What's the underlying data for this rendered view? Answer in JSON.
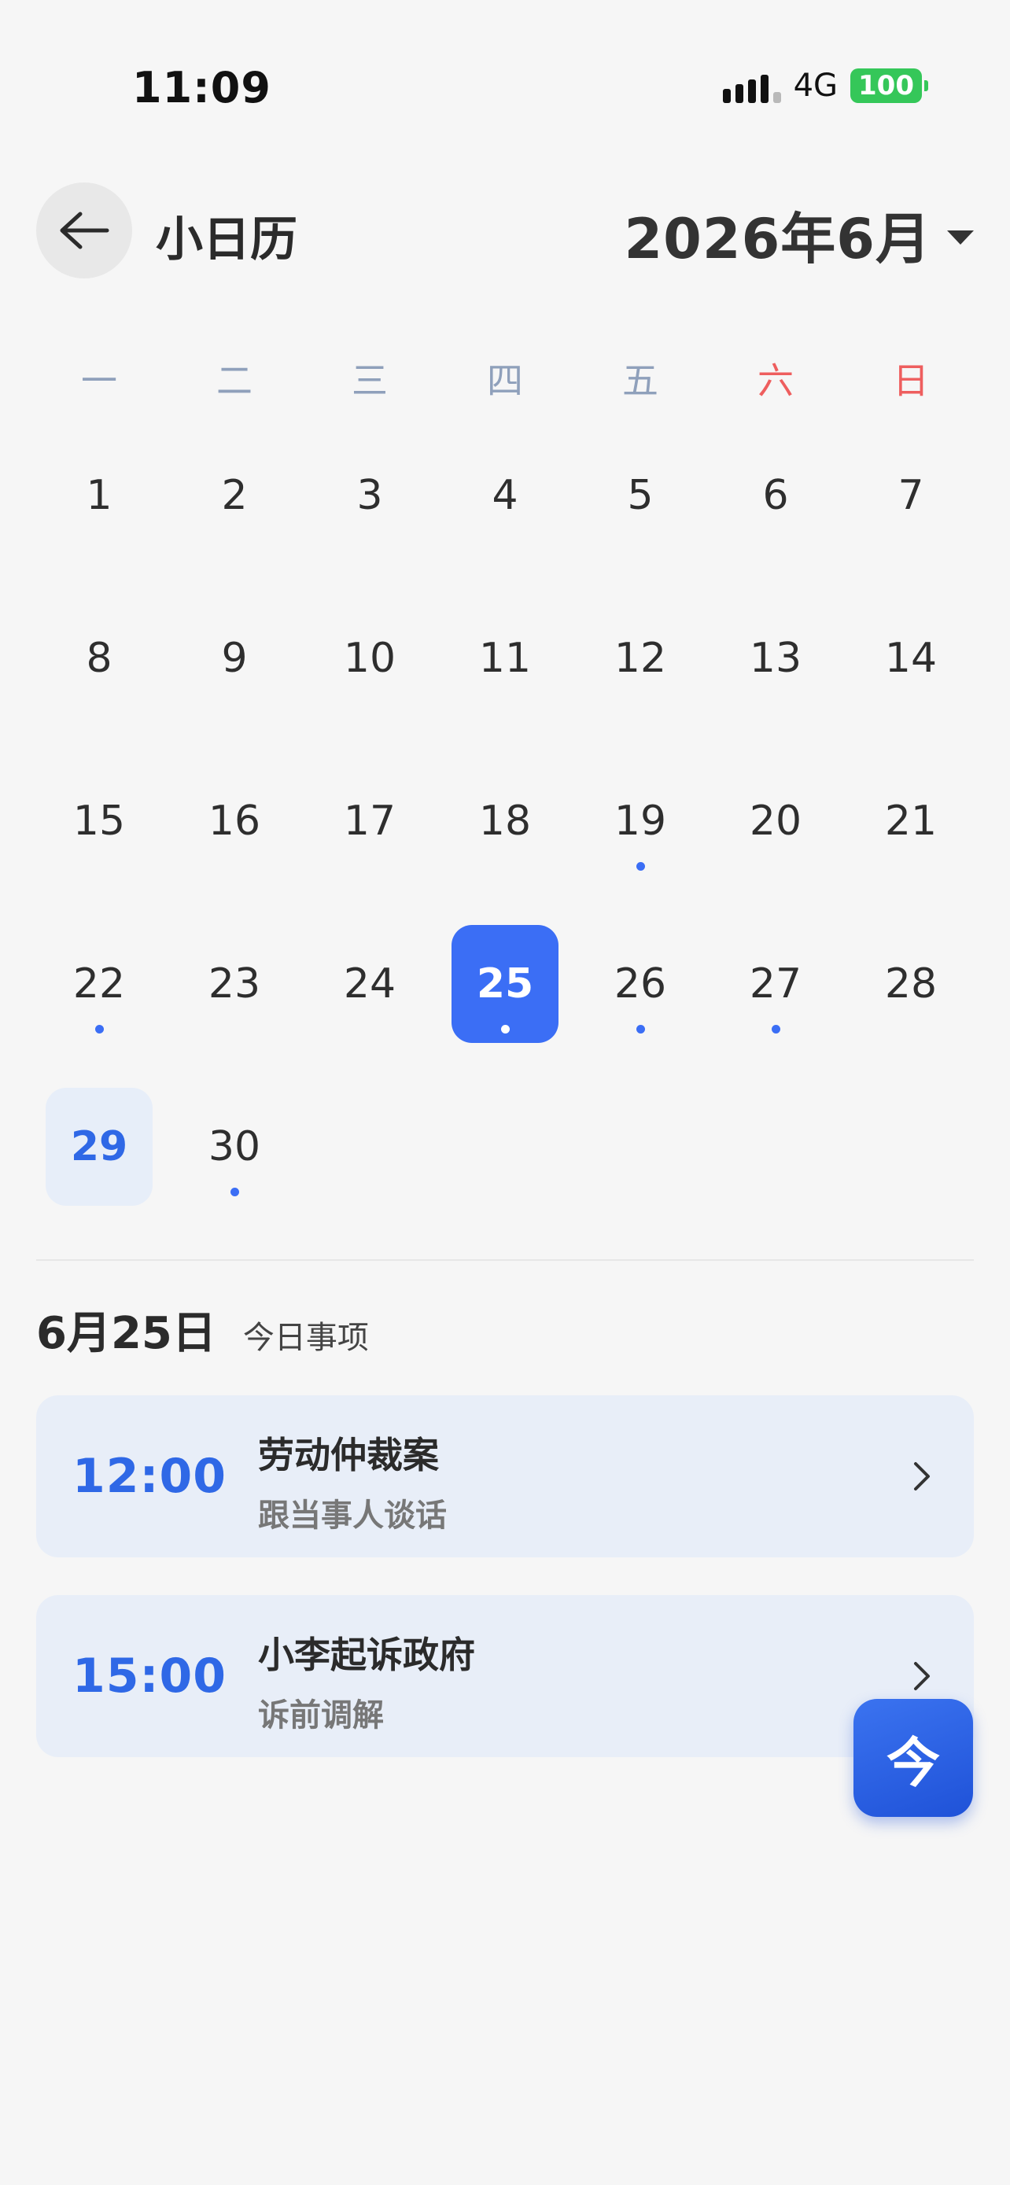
{
  "status_bar": {
    "time": "11:09",
    "network": "4G",
    "battery": "100"
  },
  "header": {
    "back_icon": "arrow-left-icon",
    "title": "小日历",
    "month": "2026年6月",
    "month_dropdown_icon": "caret-down-icon"
  },
  "calendar": {
    "weekdays": [
      "一",
      "二",
      "三",
      "四",
      "五",
      "六",
      "日"
    ],
    "weekend_color": "#ee5e5e",
    "weekday_color": "#8fa0bb",
    "accent_color": "#3b6ef5",
    "selected_day": "25",
    "today_day": "29",
    "event_days": [
      "19",
      "22",
      "25",
      "26",
      "27",
      "30"
    ],
    "weeks": [
      [
        "1",
        "2",
        "3",
        "4",
        "5",
        "6",
        "7"
      ],
      [
        "8",
        "9",
        "10",
        "11",
        "12",
        "13",
        "14"
      ],
      [
        "15",
        "16",
        "17",
        "18",
        "19",
        "20",
        "21"
      ],
      [
        "22",
        "23",
        "24",
        "25",
        "26",
        "27",
        "28"
      ],
      [
        "29",
        "30"
      ]
    ]
  },
  "agenda": {
    "date": "6月25日",
    "subtitle": "今日事项",
    "events": [
      {
        "time": "12:00",
        "title": "劳动仲裁案",
        "description": "跟当事人谈话"
      },
      {
        "time": "15:00",
        "title": "小李起诉政府",
        "description": "诉前调解"
      }
    ]
  },
  "fab": {
    "label": "今"
  }
}
